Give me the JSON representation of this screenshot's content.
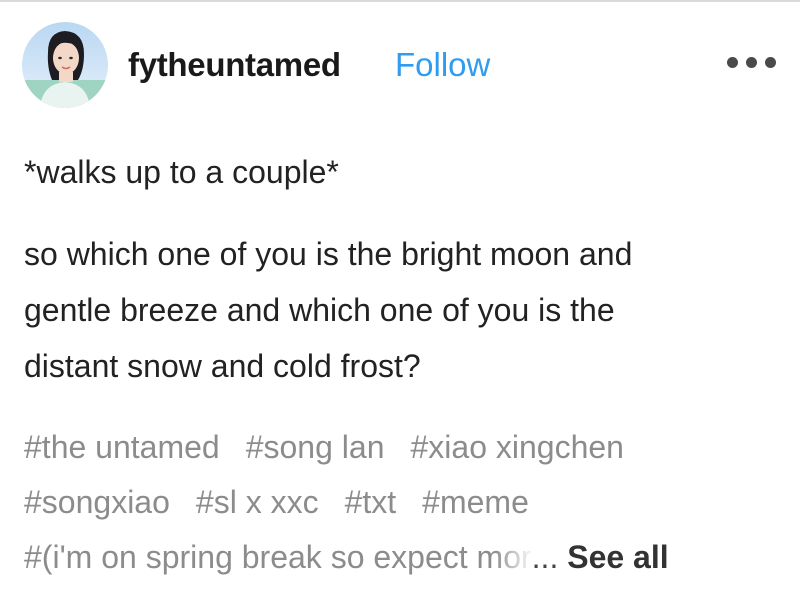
{
  "post": {
    "username": "fytheuntamed",
    "follow_label": "Follow",
    "body_line1": "*walks up to a couple*",
    "body_para2": [
      "so which one of you is the bright moon and",
      "gentle breeze and which one of you is the",
      "distant snow and cold frost?"
    ]
  },
  "tags": {
    "row1": [
      "#the untamed",
      "#song lan",
      "#xiao xingchen"
    ],
    "row2": [
      "#songxiao",
      "#sl x xxc",
      "#txt",
      "#meme"
    ],
    "row3_text": "#(i'm on spring break so expect mor",
    "ellipsis": "...",
    "see_all_label": "See all"
  },
  "icons": {
    "more": "more-options-icon",
    "avatar": "user-avatar"
  },
  "colors": {
    "follow": "#2f9cf0",
    "tags": "#8c8c8c",
    "text": "#222222"
  }
}
